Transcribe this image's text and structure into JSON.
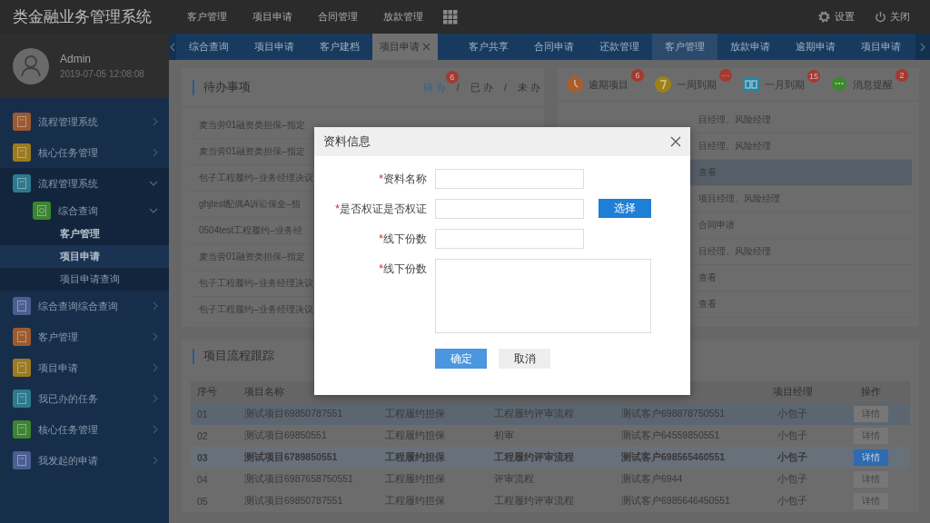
{
  "app": {
    "title": "类金融业务管理系统"
  },
  "top_nav": [
    "客户管理",
    "项目申请",
    "合同管理",
    "放款管理"
  ],
  "top_actions": [
    {
      "kind": "settings",
      "label": "设置"
    },
    {
      "kind": "power",
      "label": "关闭"
    }
  ],
  "user": {
    "name": "Admin",
    "time": "2019-07-05 12:08:08"
  },
  "sidebar": {
    "items": [
      {
        "label": "流程管理系统",
        "color": "#9c5a2e",
        "expanded": false
      },
      {
        "label": "核心任务管理",
        "color": "#9c7a1e",
        "expanded": false
      },
      {
        "label": "流程管理系统",
        "color": "#2d7a8e",
        "expanded": true,
        "children": [
          {
            "label": "综合查询",
            "color": "#3b8530",
            "expanded": true,
            "children": [
              {
                "label": "客户管理",
                "selected": false
              },
              {
                "label": "项目申请",
                "selected": true
              },
              {
                "label": "项目申请查询",
                "selected": false
              }
            ]
          }
        ]
      },
      {
        "label": "综合查询综合查询",
        "color": "#4b5e91",
        "expanded": false
      },
      {
        "label": "客户管理",
        "color": "#9c5a2e",
        "expanded": false
      },
      {
        "label": "项目申请",
        "color": "#9c7a1e",
        "expanded": false
      },
      {
        "label": "我已办的任务",
        "color": "#2d7a8e",
        "expanded": false
      },
      {
        "label": "核心任务管理",
        "color": "#3b8530",
        "expanded": false
      },
      {
        "label": "我发起的申请",
        "color": "#4b5e91",
        "expanded": false
      }
    ]
  },
  "tabs": [
    {
      "label": "综合查询",
      "selected": false,
      "highlighted": false,
      "closable": false
    },
    {
      "label": "项目申请",
      "selected": false,
      "highlighted": false,
      "closable": false
    },
    {
      "label": "客户建档",
      "selected": false,
      "highlighted": false,
      "closable": false
    },
    {
      "label": "项目申请",
      "selected": true,
      "highlighted": false,
      "closable": true
    },
    {
      "label": "客户共享",
      "selected": false,
      "highlighted": false,
      "closable": false
    },
    {
      "label": "合同申请",
      "selected": false,
      "highlighted": false,
      "closable": false
    },
    {
      "label": "还款管理",
      "selected": false,
      "highlighted": false,
      "closable": false
    },
    {
      "label": "客户管理",
      "selected": false,
      "highlighted": true,
      "closable": false
    },
    {
      "label": "放款申请",
      "selected": false,
      "highlighted": false,
      "closable": false
    },
    {
      "label": "逾期申请",
      "selected": false,
      "highlighted": false,
      "closable": false
    },
    {
      "label": "项目申请",
      "selected": false,
      "highlighted": false,
      "closable": false
    }
  ],
  "todo_panel": {
    "title": "待办事项",
    "separator": "/",
    "filters": [
      {
        "label": "待 办",
        "badge": "6",
        "selected": true
      },
      {
        "label": "已 办",
        "selected": false
      },
      {
        "label": "未 办",
        "selected": false
      }
    ],
    "rows": [
      "麦当劳01融资类担保–指定",
      "麦当劳01融资类担保–指定",
      "包子工程履约–业务经理决议",
      "ghjtest配偶A诉讼保全–指",
      "0504test工程履约–业务经",
      "麦当劳01融资类担保–指定",
      "包子工程履约–业务经理决议",
      "包子工程履约–业务经理决议"
    ]
  },
  "alerts_panel": {
    "items": [
      {
        "kind": "clock",
        "label": "逾期项目",
        "badge": "6"
      },
      {
        "kind": "week",
        "label": "一周到期",
        "badge": "···"
      },
      {
        "kind": "calendar",
        "label": "一月到期",
        "badge": "15"
      },
      {
        "kind": "chat",
        "label": "消息提醒",
        "badge": "2"
      }
    ],
    "rows": [
      {
        "text": "目经理、风险经理",
        "selected": false
      },
      {
        "text": "目经理、风险经理",
        "selected": false
      },
      {
        "text": "查看",
        "selected": true
      },
      {
        "text": "项目经理、风险经理",
        "selected": false
      },
      {
        "text": "合同申请",
        "selected": false
      },
      {
        "text": "目经理、风险经理",
        "selected": false
      },
      {
        "text": "查看",
        "selected": false
      },
      {
        "text": "查看",
        "selected": false
      }
    ]
  },
  "tracking": {
    "title": "项目流程跟踪",
    "columns": [
      "序号",
      "项目名称",
      "",
      "",
      "",
      "项目经理",
      "操作"
    ],
    "rows": [
      {
        "cells": [
          "01",
          "测试项目69850787551",
          "工程履约担保",
          "工程履约评审流程",
          "测试客户698878750551",
          "小包子"
        ],
        "action": "详情",
        "hover": true,
        "selected": false
      },
      {
        "cells": [
          "02",
          "测试项目69850551",
          "工程履约担保",
          "初审",
          "测试客户64559850551",
          "小包子"
        ],
        "action": "详情",
        "hover": false,
        "selected": false
      },
      {
        "cells": [
          "03",
          "测试项目6789850551",
          "工程履约担保",
          "工程履约评审流程",
          "测试客户698565460551",
          "小包子"
        ],
        "action": "详情",
        "hover": false,
        "selected": true
      },
      {
        "cells": [
          "04",
          "测试项目6987658750551",
          "工程履约担保",
          "评审流程",
          "测试客户6944",
          "小包子"
        ],
        "action": "详情",
        "hover": false,
        "selected": false
      },
      {
        "cells": [
          "05",
          "测试项目69850787551",
          "工程履约担保",
          "工程履约评审流程",
          "测试客户6985646450551",
          "小包子"
        ],
        "action": "详情",
        "hover": false,
        "selected": false
      }
    ]
  },
  "dialog": {
    "title": "资料信息",
    "required_mark": "*",
    "fields": [
      {
        "label": "资料名称",
        "required": true,
        "kind": "input"
      },
      {
        "label": "是否权证是否权证",
        "required": true,
        "kind": "input",
        "button": "选择"
      },
      {
        "label": "线下份数",
        "required": true,
        "kind": "input"
      },
      {
        "label": "线下份数",
        "required": true,
        "kind": "textarea"
      }
    ],
    "buttons": [
      {
        "label": "确定",
        "kind": "primary"
      },
      {
        "label": "取消",
        "kind": "secondary"
      }
    ]
  }
}
